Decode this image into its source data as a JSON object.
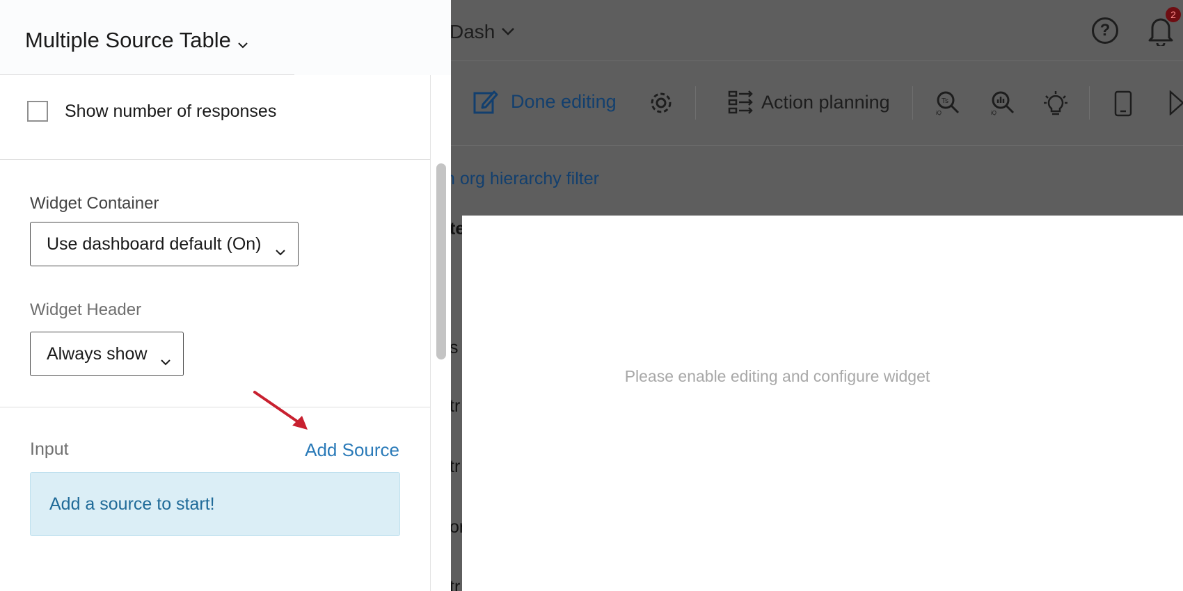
{
  "background": {
    "dashboard_title": "Dash",
    "notification_count": "2",
    "toolbar": {
      "done_editing": "Done editing",
      "action_planning": "Action planning"
    },
    "filter_link": "n org hierarchy filter",
    "fragments": [
      "te",
      "s",
      "tr",
      "tr",
      "or",
      "tr"
    ],
    "widget_message": "Please enable editing and configure widget"
  },
  "panel": {
    "title": "Multiple Source Table",
    "show_responses_label": "Show number of responses",
    "show_responses_checked": false,
    "widget_container": {
      "label": "Widget Container",
      "value": "Use dashboard default (On)"
    },
    "widget_header": {
      "label": "Widget Header",
      "value": "Always show"
    },
    "input": {
      "label": "Input",
      "add_source": "Add Source",
      "empty_message": "Add a source to start!"
    }
  },
  "colors": {
    "overlay": "#5e5e5e",
    "link_blue": "#2a7ab8",
    "info_bg": "#dbeef6",
    "annotation_arrow": "#c8202f"
  }
}
